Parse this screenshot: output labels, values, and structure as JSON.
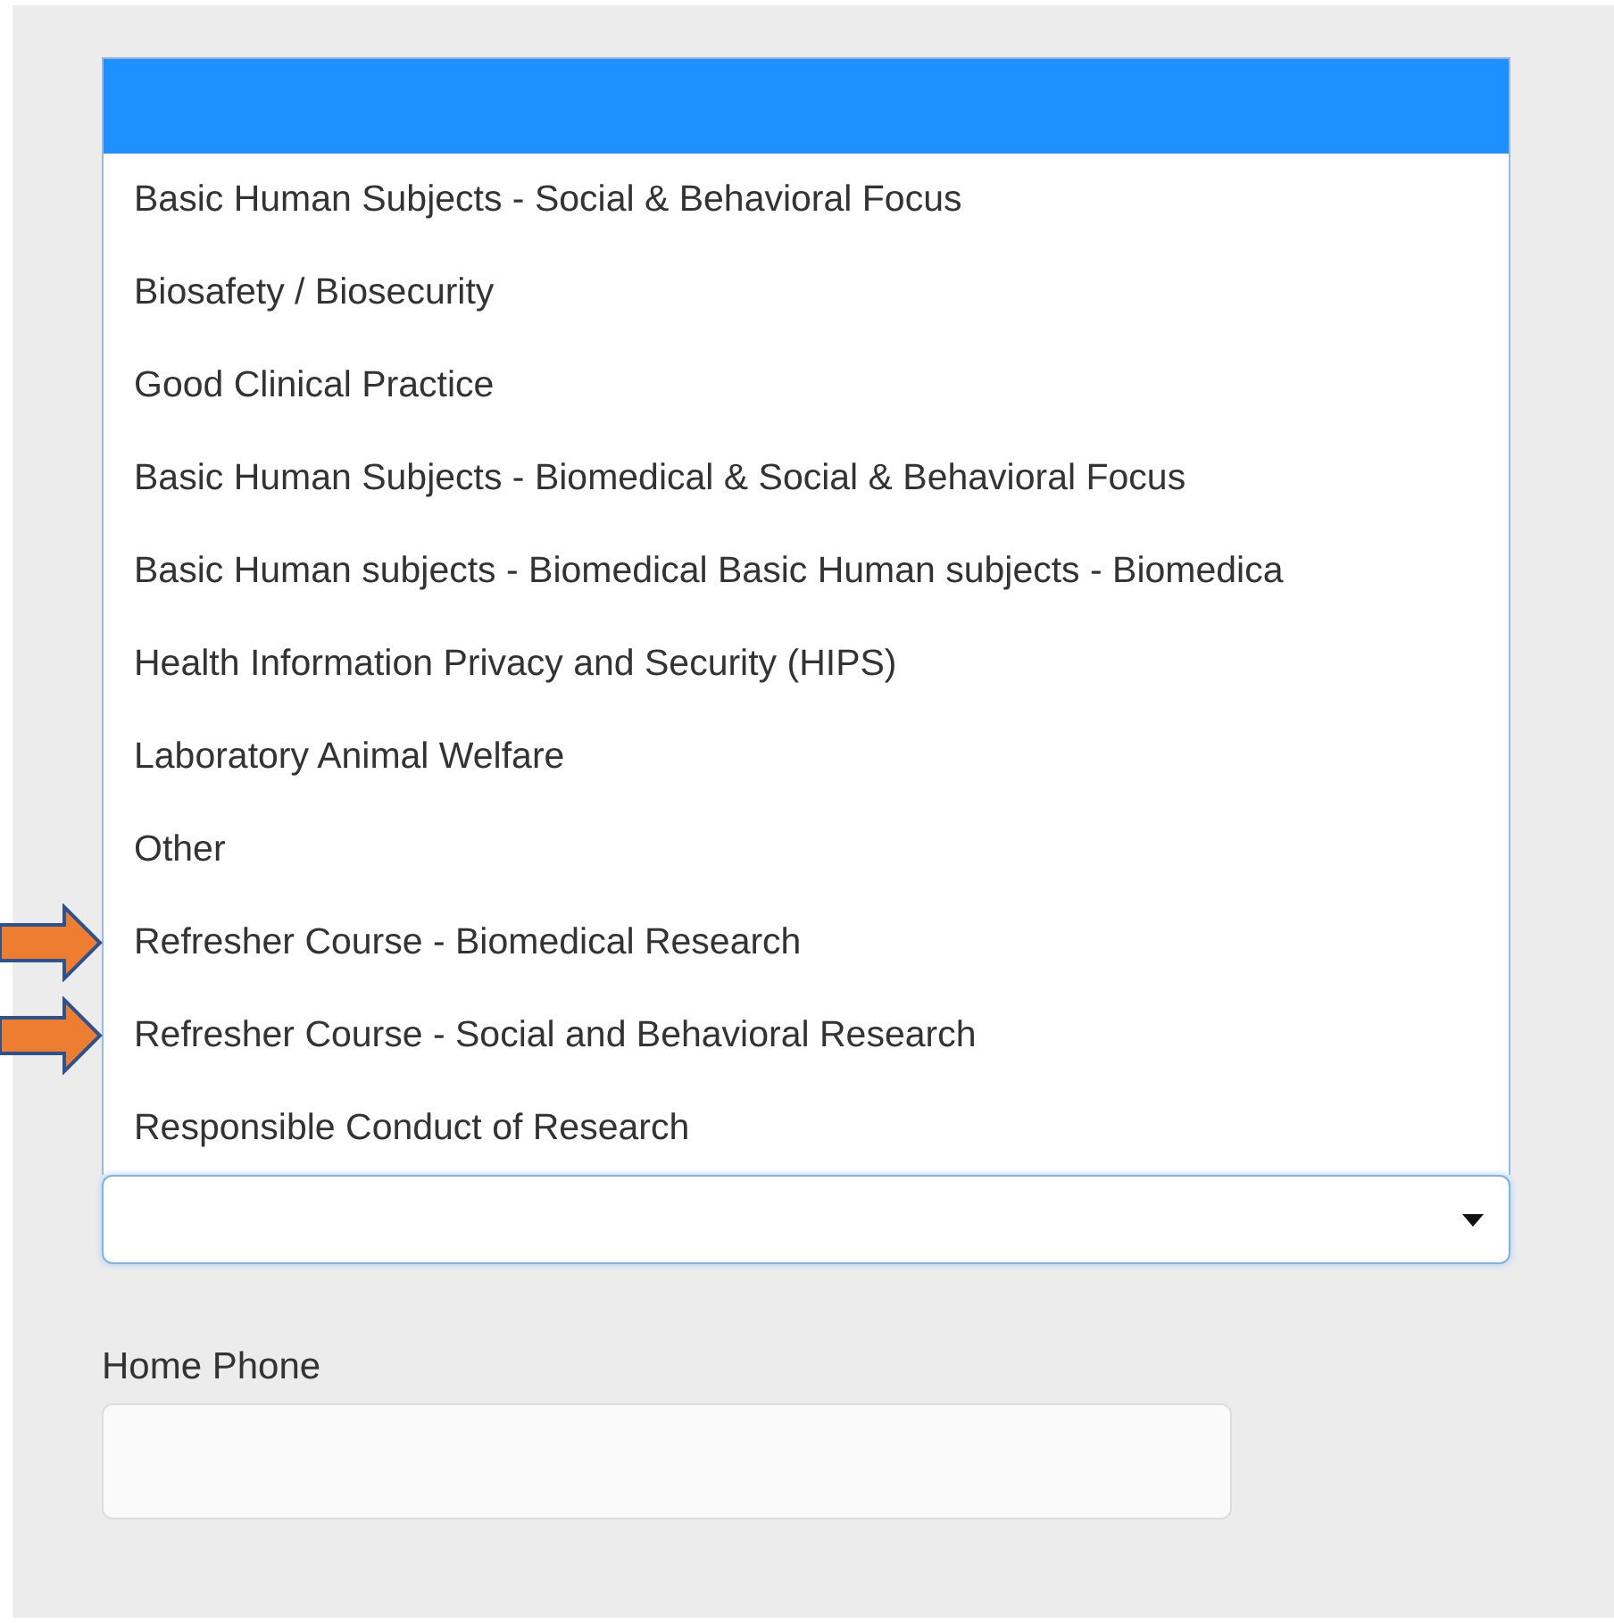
{
  "dropdown": {
    "options": [
      {
        "selected": true,
        "pointed_at": false
      },
      {
        "label": "Basic Human Subjects - Social & Behavioral Focus",
        "selected": false,
        "pointed_at": false
      },
      {
        "label": "Biosafety / Biosecurity",
        "selected": false,
        "pointed_at": false
      },
      {
        "label": "Good Clinical Practice",
        "selected": false,
        "pointed_at": false
      },
      {
        "label": "Basic Human Subjects - Biomedical & Social & Behavioral Focus",
        "selected": false,
        "pointed_at": false
      },
      {
        "label": "Basic Human subjects - Biomedical Basic Human subjects - Biomedica",
        "selected": false,
        "pointed_at": false
      },
      {
        "label": "Health Information Privacy and Security (HIPS)",
        "selected": false,
        "pointed_at": false
      },
      {
        "label": "Laboratory Animal Welfare",
        "selected": false,
        "pointed_at": false
      },
      {
        "label": "Other",
        "selected": false,
        "pointed_at": false
      },
      {
        "label": "Refresher Course - Biomedical Research",
        "selected": false,
        "pointed_at": true
      },
      {
        "label": "Refresher Course - Social and Behavioral Research",
        "selected": false,
        "pointed_at": true
      },
      {
        "label": "Responsible Conduct of Research",
        "selected": false,
        "pointed_at": false
      }
    ],
    "expanded": true
  },
  "home_phone": {
    "label": "Home Phone"
  }
}
